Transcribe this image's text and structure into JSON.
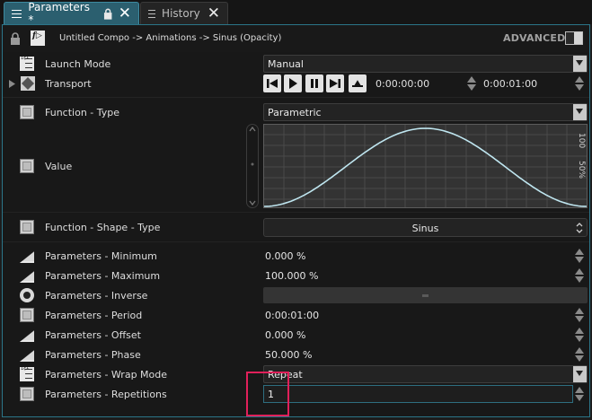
{
  "tabs": [
    {
      "label": "Parameters *",
      "active": true
    },
    {
      "label": "History",
      "active": false
    }
  ],
  "header": {
    "path": "Untitled Compo -> Animations -> Sinus (Opacity)",
    "advanced_label": "ADVANCED"
  },
  "rows": {
    "launch_mode": {
      "label": "Launch Mode",
      "value": "Manual"
    },
    "transport": {
      "label": "Transport",
      "time_start": "0:00:00:00",
      "time_end": "0:00:01:00"
    },
    "function_type": {
      "label": "Function - Type",
      "value": "Parametric"
    },
    "value": {
      "label": "Value",
      "graph_top_label": "100",
      "graph_mid_label": "50%"
    },
    "function_shape_type": {
      "label": "Function - Shape - Type",
      "value": "Sinus"
    },
    "minimum": {
      "label": "Parameters - Minimum",
      "value": "0.000 %"
    },
    "maximum": {
      "label": "Parameters - Maximum",
      "value": "100.000 %"
    },
    "inverse": {
      "label": "Parameters - Inverse"
    },
    "period": {
      "label": "Parameters - Period",
      "value": "0:00:01:00"
    },
    "offset": {
      "label": "Parameters - Offset",
      "value": "0.000 %"
    },
    "phase": {
      "label": "Parameters - Phase",
      "value": "50.000 %"
    },
    "wrap_mode": {
      "label": "Parameters - Wrap Mode",
      "value": "Repeat"
    },
    "repetitions": {
      "label": "Parameters - Repetitions",
      "value": "1"
    }
  },
  "colors": {
    "accent": "#2b7589",
    "highlight": "#e0205a",
    "curve": "#bfe6f0"
  }
}
